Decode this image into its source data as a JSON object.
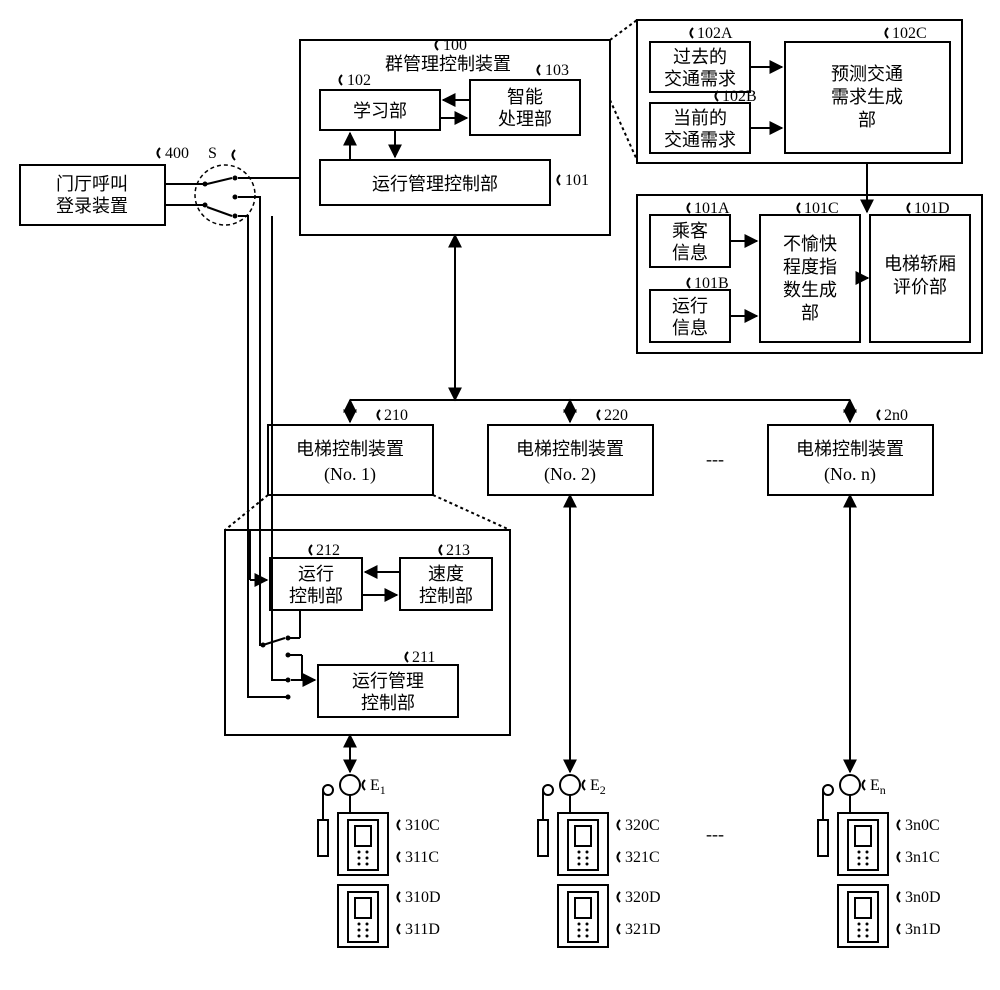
{
  "box400": {
    "ref": "400",
    "line1": "门厅呼叫",
    "line2": "登录装置"
  },
  "switch": {
    "ref": "S"
  },
  "box100": {
    "ref": "100",
    "title": "群管理控制装置"
  },
  "box102": {
    "ref": "102",
    "text": "学习部"
  },
  "box103": {
    "ref": "103",
    "line1": "智能",
    "line2": "处理部"
  },
  "box101": {
    "ref": "101",
    "text": "运行管理控制部"
  },
  "box102A": {
    "ref": "102A",
    "line1": "过去的",
    "line2": "交通需求"
  },
  "box102B": {
    "ref": "102B",
    "line1": "当前的",
    "line2": "交通需求"
  },
  "box102C": {
    "ref": "102C",
    "line1": "预测交通",
    "line2": "需求生成",
    "line3": "部"
  },
  "box101A": {
    "ref": "101A",
    "line1": "乘客",
    "line2": "信息"
  },
  "box101B": {
    "ref": "101B",
    "line1": "运行",
    "line2": "信息"
  },
  "box101C": {
    "ref": "101C",
    "line1": "不愉快",
    "line2": "程度指",
    "line3": "数生成",
    "line4": "部"
  },
  "box101D": {
    "ref": "101D",
    "line1": "电梯轿厢",
    "line2": "评价部"
  },
  "ctrl1": {
    "ref": "210",
    "line1": "电梯控制装置",
    "line2": "(No. 1)"
  },
  "ctrl2": {
    "ref": "220",
    "line1": "电梯控制装置",
    "line2": "(No. 2)"
  },
  "ctrln": {
    "ref": "2n0",
    "line1": "电梯控制装置",
    "line2": "(No. n)"
  },
  "box212": {
    "ref": "212",
    "line1": "运行",
    "line2": "控制部"
  },
  "box213": {
    "ref": "213",
    "line1": "速度",
    "line2": "控制部"
  },
  "box211": {
    "ref": "211",
    "line1": "运行管理",
    "line2": "控制部"
  },
  "elev1": {
    "ref": "E",
    "sub": "1",
    "c1": "310C",
    "c2": "311C",
    "d1": "310D",
    "d2": "311D"
  },
  "elev2": {
    "ref": "E",
    "sub": "2",
    "c1": "320C",
    "c2": "321C",
    "d1": "320D",
    "d2": "321D"
  },
  "elevn": {
    "ref": "E",
    "sub": "n",
    "c1": "3n0C",
    "c2": "3n1C",
    "d1": "3n0D",
    "d2": "3n1D"
  },
  "dash": "---"
}
